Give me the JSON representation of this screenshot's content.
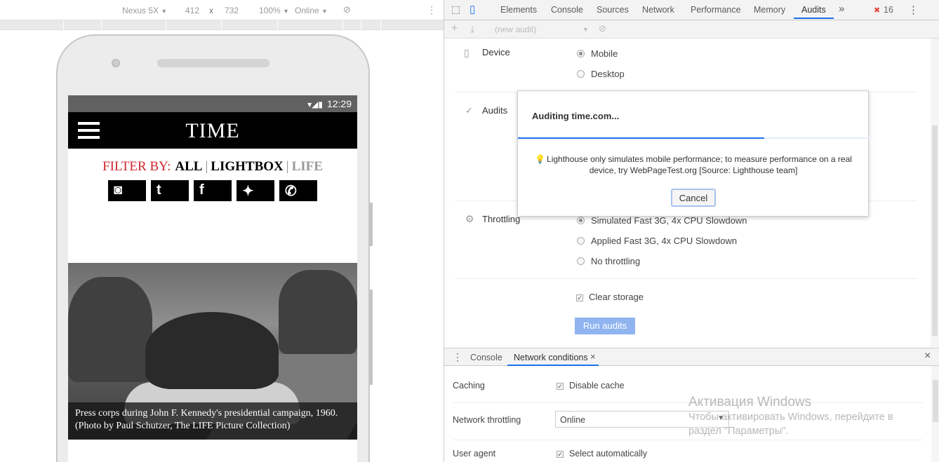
{
  "device_toolbar": {
    "device": "Nexus 5X",
    "device_caret": "▼",
    "width": "412",
    "times": "x",
    "height": "732",
    "zoom": "100%",
    "zoom_caret": "▼",
    "network": "Online",
    "network_caret": "▼",
    "rotate_icon": "⊘",
    "more_icon": "⋮"
  },
  "phone": {
    "status_time": "12:29",
    "status_icons": "▾◢▮",
    "header": {
      "logo": "TIME"
    },
    "filter": {
      "label": "FILTER BY:",
      "options": [
        "ALL",
        "LIGHTBOX",
        "LIFE"
      ],
      "separators": [
        "|",
        "|"
      ]
    },
    "social": [
      {
        "name": "instagram",
        "glyph": "◙"
      },
      {
        "name": "tumblr",
        "glyph": "t"
      },
      {
        "name": "facebook",
        "glyph": "f"
      },
      {
        "name": "twitter",
        "glyph": "✦"
      },
      {
        "name": "whatsapp",
        "glyph": "✆"
      }
    ],
    "caption": "Press corps during John F. Kennedy's presidential campaign, 1960. (Photo by Paul Schutzer, The LIFE Picture Collection)"
  },
  "devtools": {
    "tabs": [
      "Elements",
      "Console",
      "Sources",
      "Network",
      "Performance",
      "Memory",
      "Audits"
    ],
    "active_tab": "Audits",
    "more_tabs": "»",
    "error_count": "16",
    "error_icon": "✖",
    "menu_icon": "⋮",
    "inspect_icon": "⬚",
    "device_icon": "▯",
    "audit_toolbar": {
      "add": "+",
      "download": "⤓",
      "select": "(new audit)",
      "caret": "▼",
      "clear": "⊘"
    },
    "audits": {
      "device_label": "Device",
      "device_options": [
        {
          "label": "Mobile",
          "checked": true
        },
        {
          "label": "Desktop",
          "checked": false
        }
      ],
      "audits_label": "Audits",
      "throttling_label": "Throttling",
      "throttling_options": [
        {
          "label": "Simulated Fast 3G, 4x CPU Slowdown",
          "checked": true
        },
        {
          "label": "Applied Fast 3G, 4x CPU Slowdown",
          "checked": false
        },
        {
          "label": "No throttling",
          "checked": false
        }
      ],
      "clear_storage": "Clear storage",
      "clear_storage_checked": true,
      "run_button": "Run audits"
    },
    "dialog": {
      "title": "Auditing time.com...",
      "progress": 0.7,
      "message": "Lighthouse only simulates mobile performance; to measure performance on a real device, try WebPageTest.org [Source: Lighthouse team]",
      "cancel": "Cancel"
    },
    "drawer": {
      "tabs": [
        "Console",
        "Network conditions"
      ],
      "active_tab": "Network conditions",
      "close_tab": "×",
      "close_drawer": "×",
      "caching_label": "Caching",
      "caching_value": "Disable cache",
      "throttling_label": "Network throttling",
      "throttling_value": "Online",
      "user_agent_label": "User agent",
      "user_agent_value": "Select automatically"
    }
  },
  "watermark": {
    "title": "Активация Windows",
    "line1": "Чтобы активировать Windows, перейдите в",
    "line2": "раздел \"Параметры\"."
  },
  "colors": {
    "accent": "#1a73e8",
    "time_red": "#d0252d",
    "run_button": "#8fb4f0",
    "error": "#e8453c"
  }
}
